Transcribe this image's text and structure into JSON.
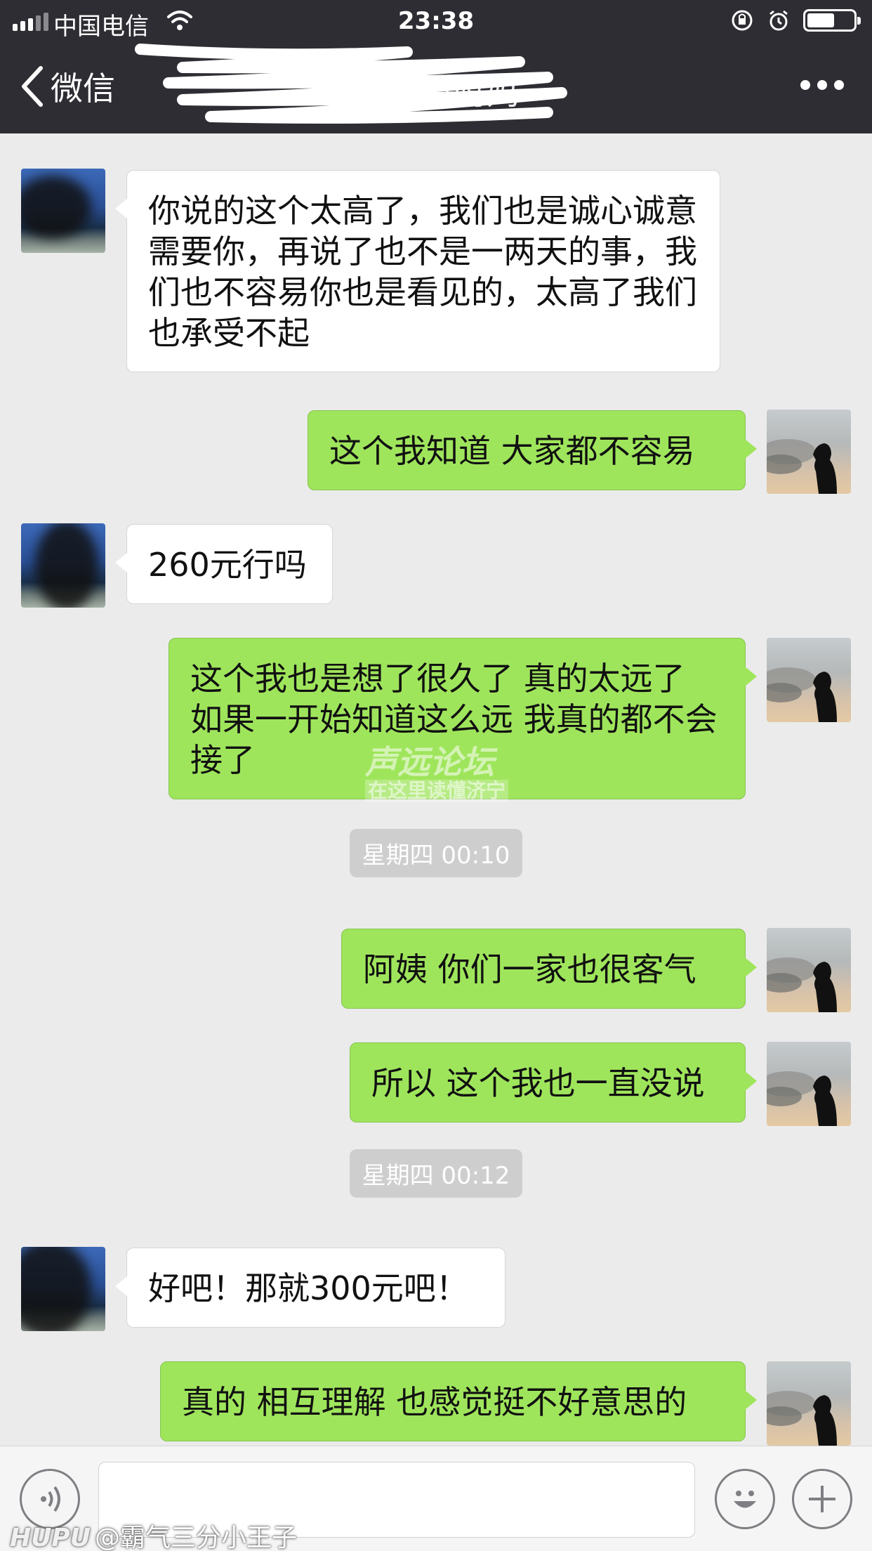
{
  "status_bar": {
    "carrier": "中国电信",
    "time": "23:38",
    "battery_level": 0.6
  },
  "nav": {
    "back_label": "微信",
    "title": "王芸姐妈妈",
    "more_icon": "more-icon"
  },
  "messages": [
    {
      "side": "other",
      "text": "你说的这个太高了，我们也是诚心诚意需要你，再说了也不是一两天的事，我们也不容易你也是看见的，太高了我们也承受不起"
    },
    {
      "side": "me",
      "text": "这个我知道 大家都不容易"
    },
    {
      "side": "other",
      "text": "260元行吗"
    },
    {
      "side": "me",
      "text": "这个我也是想了很久了 真的太远了 如果一开始知道这么远 我真的都不会接了"
    },
    {
      "side": "time",
      "text": "星期四 00:10"
    },
    {
      "side": "me",
      "text": "阿姨 你们一家也很客气"
    },
    {
      "side": "me",
      "text": "所以 这个我也一直没说"
    },
    {
      "side": "time",
      "text": "星期四 00:12"
    },
    {
      "side": "other",
      "text": "好吧！那就300元吧！"
    },
    {
      "side": "me",
      "text": "真的 相互理解 也感觉挺不好意思的"
    }
  ],
  "watermark": {
    "title": "声远论坛",
    "subtitle": "在这里读懂济宁"
  },
  "input_bar": {
    "voice_icon": "voice-icon",
    "emoji_icon": "emoji-icon",
    "add_icon": "add-icon"
  },
  "credit": {
    "logo": "HUPU",
    "handle": "@霸气三分小王子"
  }
}
